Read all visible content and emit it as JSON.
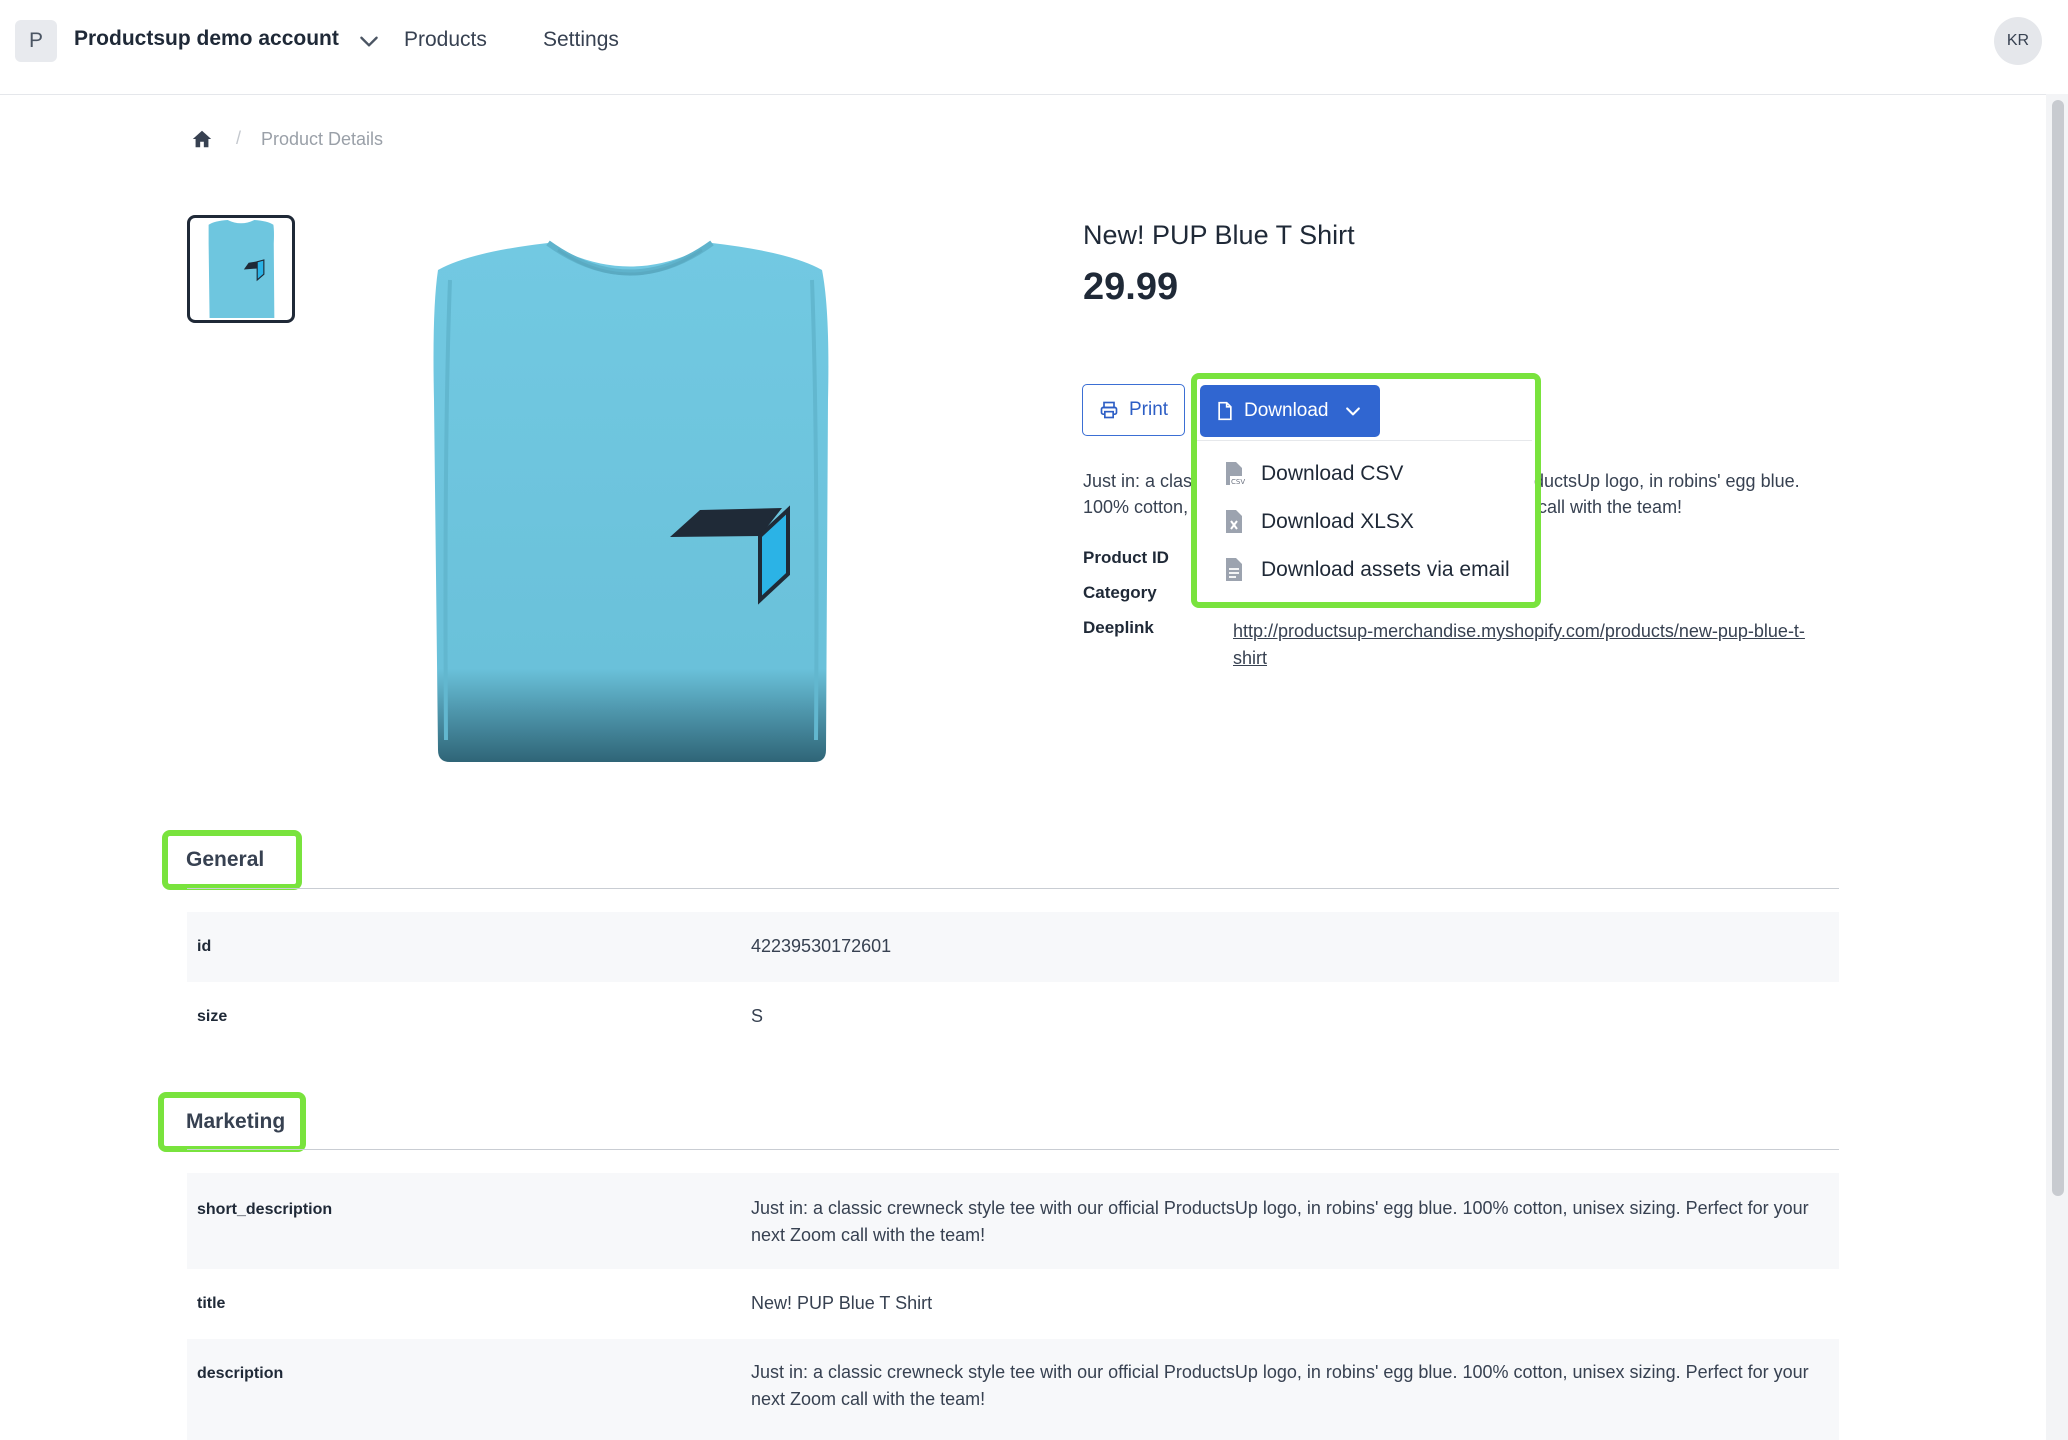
{
  "header": {
    "account_initial": "P",
    "account_name": "Productsup demo account",
    "nav": [
      "Products",
      "Settings"
    ],
    "user_initials": "KR"
  },
  "breadcrumb": {
    "current": "Product Details"
  },
  "product": {
    "title": "New! PUP Blue T Shirt",
    "price": "29.99",
    "print_label": "Print",
    "download_label": "Download",
    "download_menu": [
      {
        "label": "Download CSV",
        "icon": "csv-file-icon"
      },
      {
        "label": "Download XLSX",
        "icon": "xlsx-file-icon"
      },
      {
        "label": "Download assets via email",
        "icon": "document-icon"
      }
    ],
    "description_visible": {
      "line1_start": "Just in: a clas",
      "line1_end": "ductsUp logo, in robins' egg blue.",
      "line2_start": "100% cotton,",
      "line2_end": "call with the team!"
    },
    "info_labels": {
      "product_id": "Product ID",
      "category": "Category",
      "deeplink": "Deeplink"
    },
    "deeplink": "http://productsup-merchandise.myshopify.com/products/new-pup-blue-t-shirt"
  },
  "sections": {
    "general": {
      "title": "General",
      "rows": [
        {
          "key": "id",
          "value": "42239530172601"
        },
        {
          "key": "size",
          "value": "S"
        }
      ]
    },
    "marketing": {
      "title": "Marketing",
      "rows": [
        {
          "key": "short_description",
          "value": "Just in: a classic crewneck style tee with our official ProductsUp logo, in robins' egg blue. 100% cotton, unisex sizing. Perfect for your next Zoom call with the team!"
        },
        {
          "key": "title",
          "value": "New! PUP Blue T Shirt"
        },
        {
          "key": "description",
          "value": "Just in: a classic crewneck style tee with our official ProductsUp logo, in robins' egg blue. 100% cotton, unisex sizing. Perfect for your next Zoom call with the team!"
        }
      ]
    }
  },
  "colors": {
    "primary": "#3066d1",
    "highlight": "#79e33d",
    "shirt": "#6ec6df"
  }
}
